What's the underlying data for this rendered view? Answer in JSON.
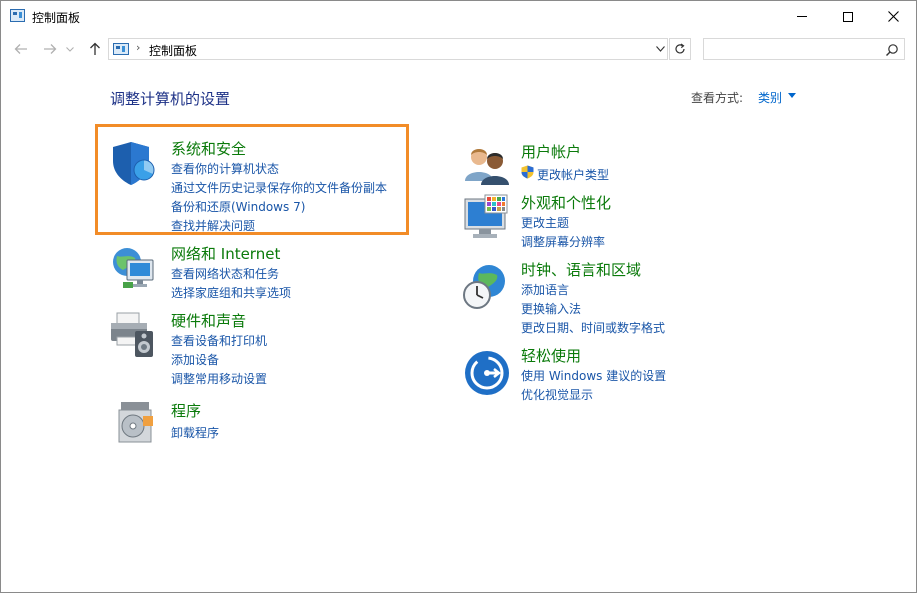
{
  "window": {
    "title": "控制面板"
  },
  "address": {
    "path": "控制面板",
    "search_placeholder": ""
  },
  "header": {
    "title": "调整计算机的设置",
    "view_by_label": "查看方式:",
    "view_by_value": "类别"
  },
  "left_categories": [
    {
      "title": "系统和安全",
      "links": [
        "查看你的计算机状态",
        "通过文件历史记录保存你的文件备份副本",
        "备份和还原(Windows 7)",
        "查找并解决问题"
      ]
    },
    {
      "title": "网络和 Internet",
      "links": [
        "查看网络状态和任务",
        "选择家庭组和共享选项"
      ]
    },
    {
      "title": "硬件和声音",
      "links": [
        "查看设备和打印机",
        "添加设备",
        "调整常用移动设置"
      ]
    },
    {
      "title": "程序",
      "links": [
        "卸载程序"
      ]
    }
  ],
  "right_categories": [
    {
      "title": "用户帐户",
      "links": [
        "更改帐户类型"
      ]
    },
    {
      "title": "外观和个性化",
      "links": [
        "更改主题",
        "调整屏幕分辨率"
      ]
    },
    {
      "title": "时钟、语言和区域",
      "links": [
        "添加语言",
        "更换输入法",
        "更改日期、时间或数字格式"
      ]
    },
    {
      "title": "轻松使用",
      "links": [
        "使用 Windows 建议的设置",
        "优化视觉显示"
      ]
    }
  ],
  "colors": {
    "category_title": "#0a7a0a",
    "link": "#1a56a8",
    "page_title": "#1e3287",
    "highlight": "#f28c28"
  }
}
